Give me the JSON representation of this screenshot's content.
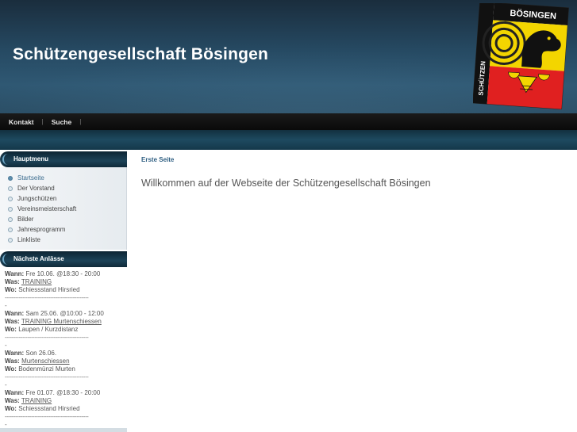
{
  "header": {
    "title": "Schützengesellschaft Bösingen",
    "crest": {
      "top_text": "BÖSINGEN",
      "side_text": "SCHÜTZEN"
    }
  },
  "nav": {
    "items": [
      "Kontakt",
      "Suche"
    ],
    "separator": "|"
  },
  "sidebar": {
    "main_menu_title": "Hauptmenu",
    "menu_items": [
      {
        "label": "Startseite",
        "active": true
      },
      {
        "label": "Der Vorstand"
      },
      {
        "label": "Jungschützen"
      },
      {
        "label": "Vereinsmeisterschaft"
      },
      {
        "label": "Bilder"
      },
      {
        "label": "Jahresprogramm"
      },
      {
        "label": "Linkliste"
      }
    ],
    "events_title": "Nächste Anlässe",
    "labels": {
      "wann": "Wann:",
      "was": "Was:",
      "wo": "Wo:"
    },
    "separator": "------------------------------------------------",
    "dash": "-",
    "events": [
      {
        "wann": "Fre 10.06. @18:30 - 20:00",
        "was": "TRAINING ",
        "wo": "Schiessstand Hirsried"
      },
      {
        "wann": "Sam 25.06. @10:00 - 12:00",
        "was": "TRAINING Murtenschiessen ",
        "wo": "Laupen / Kurzdistanz"
      },
      {
        "wann": "Son 26.06.",
        "was": "Murtenschiessen ",
        "wo": "Bodenmünzi Murten"
      },
      {
        "wann": "Fre 01.07. @18:30 - 20:00",
        "was": "TRAINING ",
        "wo": "Schiessstand Hirsried"
      }
    ]
  },
  "main": {
    "breadcrumb": "Erste Seite",
    "welcome": "Willkommen auf der Webseite der Schützengesellschaft Bösingen"
  },
  "colors": {
    "header_dark": "#1a2d3d",
    "nav_bg": "#0a0a0a",
    "accent_link": "#2f5f82",
    "crest_red": "#e02020",
    "crest_yellow": "#f3d500"
  }
}
